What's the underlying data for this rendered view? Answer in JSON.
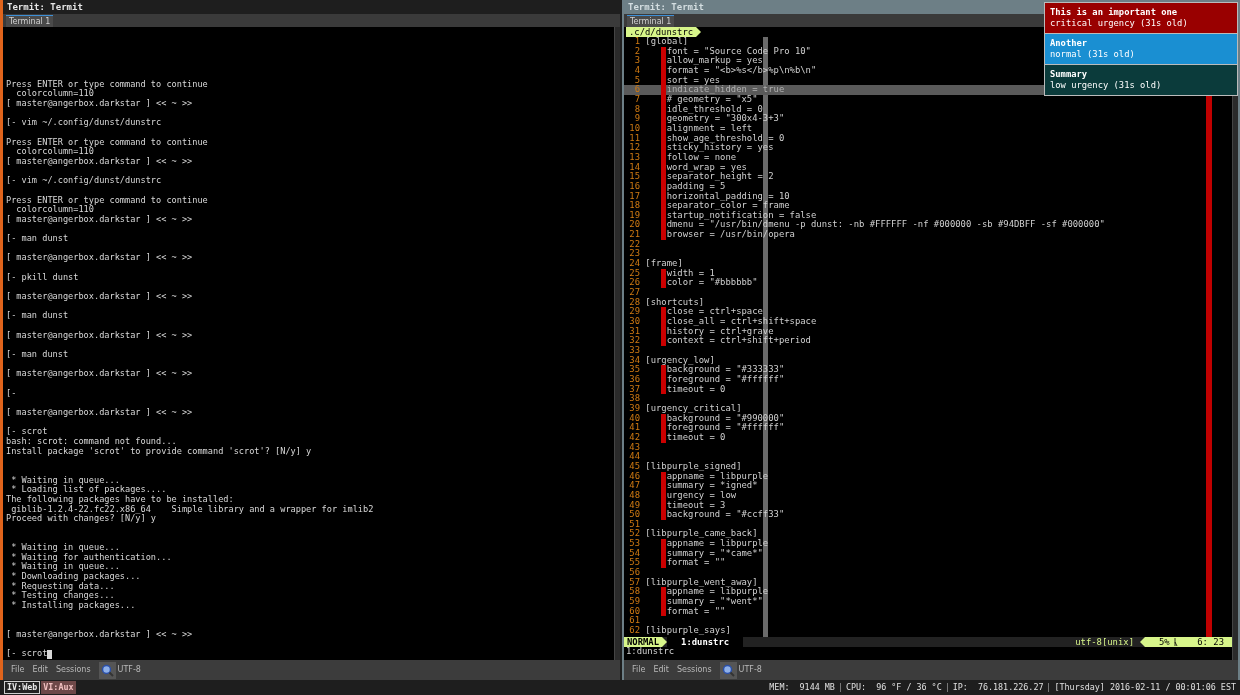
{
  "left_window": {
    "title": "Termit: Termit",
    "tab": {
      "label": "Terminal 1",
      "selected": true
    },
    "lines": [
      {
        "kind": "text",
        "text": "Press ENTER or type command to continue"
      },
      {
        "kind": "text",
        "text": "  colorcolumn=110"
      },
      {
        "kind": "text",
        "text": "[ master@angerbox.darkstar ] << ~ >>"
      },
      {
        "kind": "blank"
      },
      {
        "kind": "text",
        "text": "[- vim ~/.config/dunst/dunstrc"
      },
      {
        "kind": "blank"
      },
      {
        "kind": "text",
        "text": "Press ENTER or type command to continue"
      },
      {
        "kind": "text",
        "text": "  colorcolumn=110"
      },
      {
        "kind": "text",
        "text": "[ master@angerbox.darkstar ] << ~ >>"
      },
      {
        "kind": "blank"
      },
      {
        "kind": "text",
        "text": "[- vim ~/.config/dunst/dunstrc"
      },
      {
        "kind": "blank"
      },
      {
        "kind": "text",
        "text": "Press ENTER or type command to continue"
      },
      {
        "kind": "text",
        "text": "  colorcolumn=110"
      },
      {
        "kind": "text",
        "text": "[ master@angerbox.darkstar ] << ~ >>"
      },
      {
        "kind": "blank"
      },
      {
        "kind": "text",
        "text": "[- man dunst"
      },
      {
        "kind": "blank"
      },
      {
        "kind": "text",
        "text": "[ master@angerbox.darkstar ] << ~ >>"
      },
      {
        "kind": "blank"
      },
      {
        "kind": "text",
        "text": "[- pkill dunst"
      },
      {
        "kind": "blank"
      },
      {
        "kind": "text",
        "text": "[ master@angerbox.darkstar ] << ~ >>"
      },
      {
        "kind": "blank"
      },
      {
        "kind": "text",
        "text": "[- man dunst"
      },
      {
        "kind": "blank"
      },
      {
        "kind": "text",
        "text": "[ master@angerbox.darkstar ] << ~ >>"
      },
      {
        "kind": "blank"
      },
      {
        "kind": "text",
        "text": "[- man dunst"
      },
      {
        "kind": "blank"
      },
      {
        "kind": "text",
        "text": "[ master@angerbox.darkstar ] << ~ >>"
      },
      {
        "kind": "blank"
      },
      {
        "kind": "text",
        "text": "[-"
      },
      {
        "kind": "blank"
      },
      {
        "kind": "text",
        "text": "[ master@angerbox.darkstar ] << ~ >>"
      },
      {
        "kind": "blank"
      },
      {
        "kind": "text",
        "text": "[- scrot"
      },
      {
        "kind": "text",
        "text": "bash: scrot: command not found..."
      },
      {
        "kind": "text",
        "text": "Install package 'scrot' to provide command 'scrot'? [N/y] y"
      },
      {
        "kind": "blank"
      },
      {
        "kind": "blank"
      },
      {
        "kind": "text",
        "text": " * Waiting in queue..."
      },
      {
        "kind": "text",
        "text": " * Loading list of packages...."
      },
      {
        "kind": "text",
        "text": "The following packages have to be installed:"
      },
      {
        "kind": "text",
        "text": " giblib-1.2.4-22.fc22.x86_64    Simple library and a wrapper for imlib2"
      },
      {
        "kind": "text",
        "text": "Proceed with changes? [N/y] y"
      },
      {
        "kind": "blank"
      },
      {
        "kind": "blank"
      },
      {
        "kind": "text",
        "text": " * Waiting in queue..."
      },
      {
        "kind": "text",
        "text": " * Waiting for authentication..."
      },
      {
        "kind": "text",
        "text": " * Waiting in queue..."
      },
      {
        "kind": "text",
        "text": " * Downloading packages..."
      },
      {
        "kind": "text",
        "text": " * Requesting data..."
      },
      {
        "kind": "text",
        "text": " * Testing changes..."
      },
      {
        "kind": "text",
        "text": " * Installing packages..."
      },
      {
        "kind": "blank"
      },
      {
        "kind": "blank"
      },
      {
        "kind": "text",
        "text": "[ master@angerbox.darkstar ] << ~ >>"
      },
      {
        "kind": "blank"
      }
    ],
    "prompt": "[- scrot",
    "menu": [
      "File",
      "Edit",
      "Sessions"
    ],
    "encoding": "UTF-8"
  },
  "right_window": {
    "title": "Termit: Termit",
    "tab": {
      "label": "Terminal 1",
      "selected": true
    },
    "path": ".c/d/dunstrc",
    "code_lines": [
      {
        "n": "1",
        "kind": "section",
        "text": "[global]",
        "current": false
      },
      {
        "n": "2",
        "kind": "setting",
        "text": "font = \"Source Code Pro 10\"",
        "current": false
      },
      {
        "n": "3",
        "kind": "setting",
        "text": "allow_markup = yes",
        "current": false
      },
      {
        "n": "4",
        "kind": "setting",
        "text": "format = \"<b>%s</b>%p\\n%b\\n\"",
        "current": false
      },
      {
        "n": "5",
        "kind": "setting",
        "text": "sort = yes",
        "current": false
      },
      {
        "n": "6",
        "kind": "setting",
        "text": "indicate_hidden = true",
        "current": true
      },
      {
        "n": "7",
        "kind": "setting",
        "text": "# geometry = \"x5\"",
        "current": false
      },
      {
        "n": "8",
        "kind": "setting",
        "text": "idle_threshold = 0",
        "current": false
      },
      {
        "n": "9",
        "kind": "setting",
        "text": "geometry = \"300x4-3+3\"",
        "current": false
      },
      {
        "n": "10",
        "kind": "setting",
        "text": "alignment = left",
        "current": false
      },
      {
        "n": "11",
        "kind": "setting",
        "text": "show_age_threshold = 0",
        "current": false
      },
      {
        "n": "12",
        "kind": "setting",
        "text": "sticky_history = yes",
        "current": false
      },
      {
        "n": "13",
        "kind": "setting",
        "text": "follow = none",
        "current": false
      },
      {
        "n": "14",
        "kind": "setting",
        "text": "word_wrap = yes",
        "current": false
      },
      {
        "n": "15",
        "kind": "setting",
        "text": "separator_height = 2",
        "current": false
      },
      {
        "n": "16",
        "kind": "setting",
        "text": "padding = 5",
        "current": false
      },
      {
        "n": "17",
        "kind": "setting",
        "text": "horizontal_padding = 10",
        "current": false
      },
      {
        "n": "18",
        "kind": "setting",
        "text": "separator_color = frame",
        "current": false
      },
      {
        "n": "19",
        "kind": "setting",
        "text": "startup_notification = false",
        "current": false
      },
      {
        "n": "20",
        "kind": "setting",
        "text": "dmenu = \"/usr/bin/dmenu -p dunst: -nb #FFFFFF -nf #000000 -sb #94DBFF -sf #000000\"",
        "current": false
      },
      {
        "n": "21",
        "kind": "setting",
        "text": "browser = /usr/bin/opera",
        "current": false
      },
      {
        "n": "22",
        "kind": "blank",
        "current": false
      },
      {
        "n": "23",
        "kind": "blank",
        "current": false
      },
      {
        "n": "24",
        "kind": "section",
        "text": "[frame]",
        "current": false
      },
      {
        "n": "25",
        "kind": "setting",
        "text": "width = 1",
        "current": false
      },
      {
        "n": "26",
        "kind": "setting",
        "text": "color = \"#bbbbbb\"",
        "current": false
      },
      {
        "n": "27",
        "kind": "blank",
        "current": false
      },
      {
        "n": "28",
        "kind": "section",
        "text": "[shortcuts]",
        "current": false
      },
      {
        "n": "29",
        "kind": "setting",
        "text": "close = ctrl+space",
        "current": false
      },
      {
        "n": "30",
        "kind": "setting",
        "text": "close_all = ctrl+shift+space",
        "current": false
      },
      {
        "n": "31",
        "kind": "setting",
        "text": "history = ctrl+grave",
        "current": false
      },
      {
        "n": "32",
        "kind": "setting",
        "text": "context = ctrl+shift+period",
        "current": false
      },
      {
        "n": "33",
        "kind": "blank",
        "current": false
      },
      {
        "n": "34",
        "kind": "section",
        "text": "[urgency_low]",
        "current": false
      },
      {
        "n": "35",
        "kind": "setting",
        "text": "background = \"#333333\"",
        "current": false
      },
      {
        "n": "36",
        "kind": "setting",
        "text": "foreground = \"#ffffff\"",
        "current": false
      },
      {
        "n": "37",
        "kind": "setting",
        "text": "timeout = 0",
        "current": false
      },
      {
        "n": "38",
        "kind": "blank",
        "current": false
      },
      {
        "n": "39",
        "kind": "section",
        "text": "[urgency_critical]",
        "current": false
      },
      {
        "n": "40",
        "kind": "setting",
        "text": "background = \"#990000\"",
        "current": false
      },
      {
        "n": "41",
        "kind": "setting",
        "text": "foreground = \"#ffffff\"",
        "current": false
      },
      {
        "n": "42",
        "kind": "setting",
        "text": "timeout = 0",
        "current": false
      },
      {
        "n": "43",
        "kind": "blank",
        "current": false
      },
      {
        "n": "44",
        "kind": "blank",
        "current": false
      },
      {
        "n": "45",
        "kind": "section",
        "text": "[libpurple_signed]",
        "current": false
      },
      {
        "n": "46",
        "kind": "setting",
        "text": "appname = libpurple",
        "current": false
      },
      {
        "n": "47",
        "kind": "setting",
        "text": "summary = *igned*",
        "current": false
      },
      {
        "n": "48",
        "kind": "setting",
        "text": "urgency = low",
        "current": false
      },
      {
        "n": "49",
        "kind": "setting",
        "text": "timeout = 3",
        "current": false
      },
      {
        "n": "50",
        "kind": "setting",
        "text": "background = \"#ccff33\"",
        "current": false
      },
      {
        "n": "51",
        "kind": "blank",
        "current": false
      },
      {
        "n": "52",
        "kind": "section",
        "text": "[libpurple_came_back]",
        "current": false
      },
      {
        "n": "53",
        "kind": "setting",
        "text": "appname = libpurple",
        "current": false
      },
      {
        "n": "54",
        "kind": "setting",
        "text": "summary = \"*came*\"",
        "current": false
      },
      {
        "n": "55",
        "kind": "setting",
        "text": "format = \"\"",
        "current": false
      },
      {
        "n": "56",
        "kind": "blank",
        "current": false
      },
      {
        "n": "57",
        "kind": "section",
        "text": "[libpurple_went_away]",
        "current": false
      },
      {
        "n": "58",
        "kind": "setting",
        "text": "appname = libpurple",
        "current": false
      },
      {
        "n": "59",
        "kind": "setting",
        "text": "summary = \"*went*\"",
        "current": false
      },
      {
        "n": "60",
        "kind": "setting",
        "text": "format = \"\"",
        "current": false
      },
      {
        "n": "61",
        "kind": "blank",
        "current": false
      },
      {
        "n": "62",
        "kind": "section",
        "text": "[libpurple_says]",
        "current": false
      }
    ],
    "mode": "NORMAL",
    "buffer": "1:dunstrc",
    "file_format": "utf-8[unix]",
    "percent": "5%",
    "position": "6: 23",
    "command_line": "1:dunstrc",
    "menu": [
      "File",
      "Edit",
      "Sessions"
    ],
    "encoding": "UTF-8"
  },
  "notifications": [
    {
      "title": "This is an important one",
      "body": "critical urgency (31s old)",
      "color": "#990000"
    },
    {
      "title": "Another",
      "body": "normal (31s old)",
      "color": "#1a8fd2"
    },
    {
      "title": "Summary",
      "body": "low urgency (31s old)",
      "color": "#0b3b3b"
    }
  ],
  "workspaces": [
    {
      "label": "IV:Web",
      "selected": true
    },
    {
      "label": "VI:Aux",
      "selected": false
    }
  ],
  "status": [
    "MEM:  9144 MB",
    "CPU:  96 °F / 36 °C",
    "IP:  76.181.226.27",
    "[Thursday] 2016-02-11 / 00:01:06 EST"
  ]
}
